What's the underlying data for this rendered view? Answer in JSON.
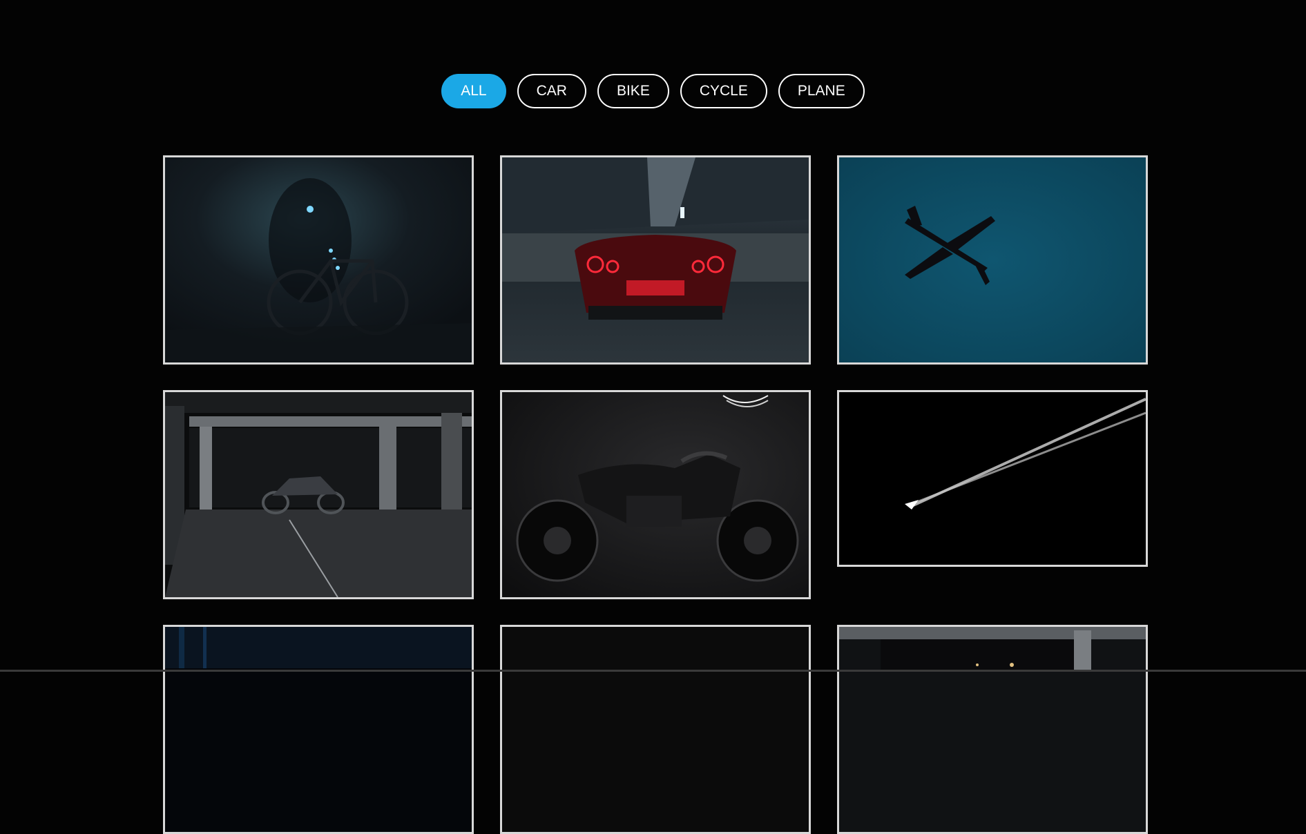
{
  "filters": {
    "all": "ALL",
    "car": "CAR",
    "bike": "BIKE",
    "cycle": "CYCLE",
    "plane": "PLANE"
  },
  "accent_color": "#1ba8e6",
  "gallery": {
    "items": [
      {
        "subject": "bicycle in dark tunnel",
        "category": "cycle"
      },
      {
        "subject": "red sports car rear in parking garage",
        "category": "car"
      },
      {
        "subject": "airplane silhouette against teal sky",
        "category": "plane"
      },
      {
        "subject": "motorcycle in underground parking",
        "category": "bike"
      },
      {
        "subject": "black motorcycle side view",
        "category": "bike"
      },
      {
        "subject": "airplane with contrails on black sky",
        "category": "plane"
      },
      {
        "subject": "dark blue image (partially visible)",
        "category": "unknown"
      },
      {
        "subject": "dark image (partially visible)",
        "category": "unknown"
      },
      {
        "subject": "parking garage (partially visible)",
        "category": "unknown"
      }
    ]
  }
}
